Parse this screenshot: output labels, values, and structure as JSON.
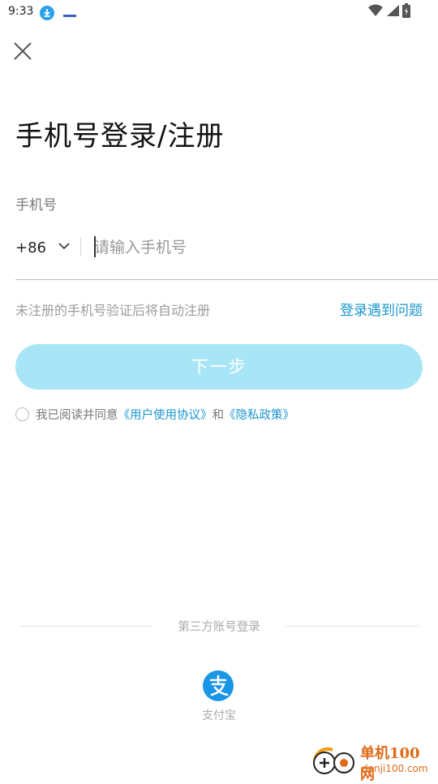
{
  "status_bar": {
    "time": "9:33",
    "icons": [
      "download-icon",
      "notification-icon",
      "wifi-icon",
      "signal-icon",
      "battery-icon"
    ]
  },
  "header": {
    "close_icon": "close-icon",
    "title": "手机号登录/注册"
  },
  "form": {
    "phone_label": "手机号",
    "country_code": "+86",
    "phone_placeholder": "请输入手机号",
    "phone_value": "",
    "hint": "未注册的手机号验证后将自动注册",
    "help_link": "登录遇到问题",
    "next_button": "下一步",
    "agreement": {
      "prefix": "我已阅读并同意",
      "terms_link": "《用户使用协议》",
      "and": "和",
      "privacy_link": "《隐私政策》",
      "checked": false
    }
  },
  "third_party": {
    "heading": "第三方账号登录",
    "alipay_label": "支付宝",
    "alipay_icon": "alipay-icon"
  },
  "watermark": {
    "name": "单机100网",
    "domain": "danji100.com"
  },
  "colors": {
    "accent": "#1a96cf",
    "button_disabled": "#a8e6f7",
    "alipay": "#1a96e6",
    "watermark": "#e06a17"
  }
}
